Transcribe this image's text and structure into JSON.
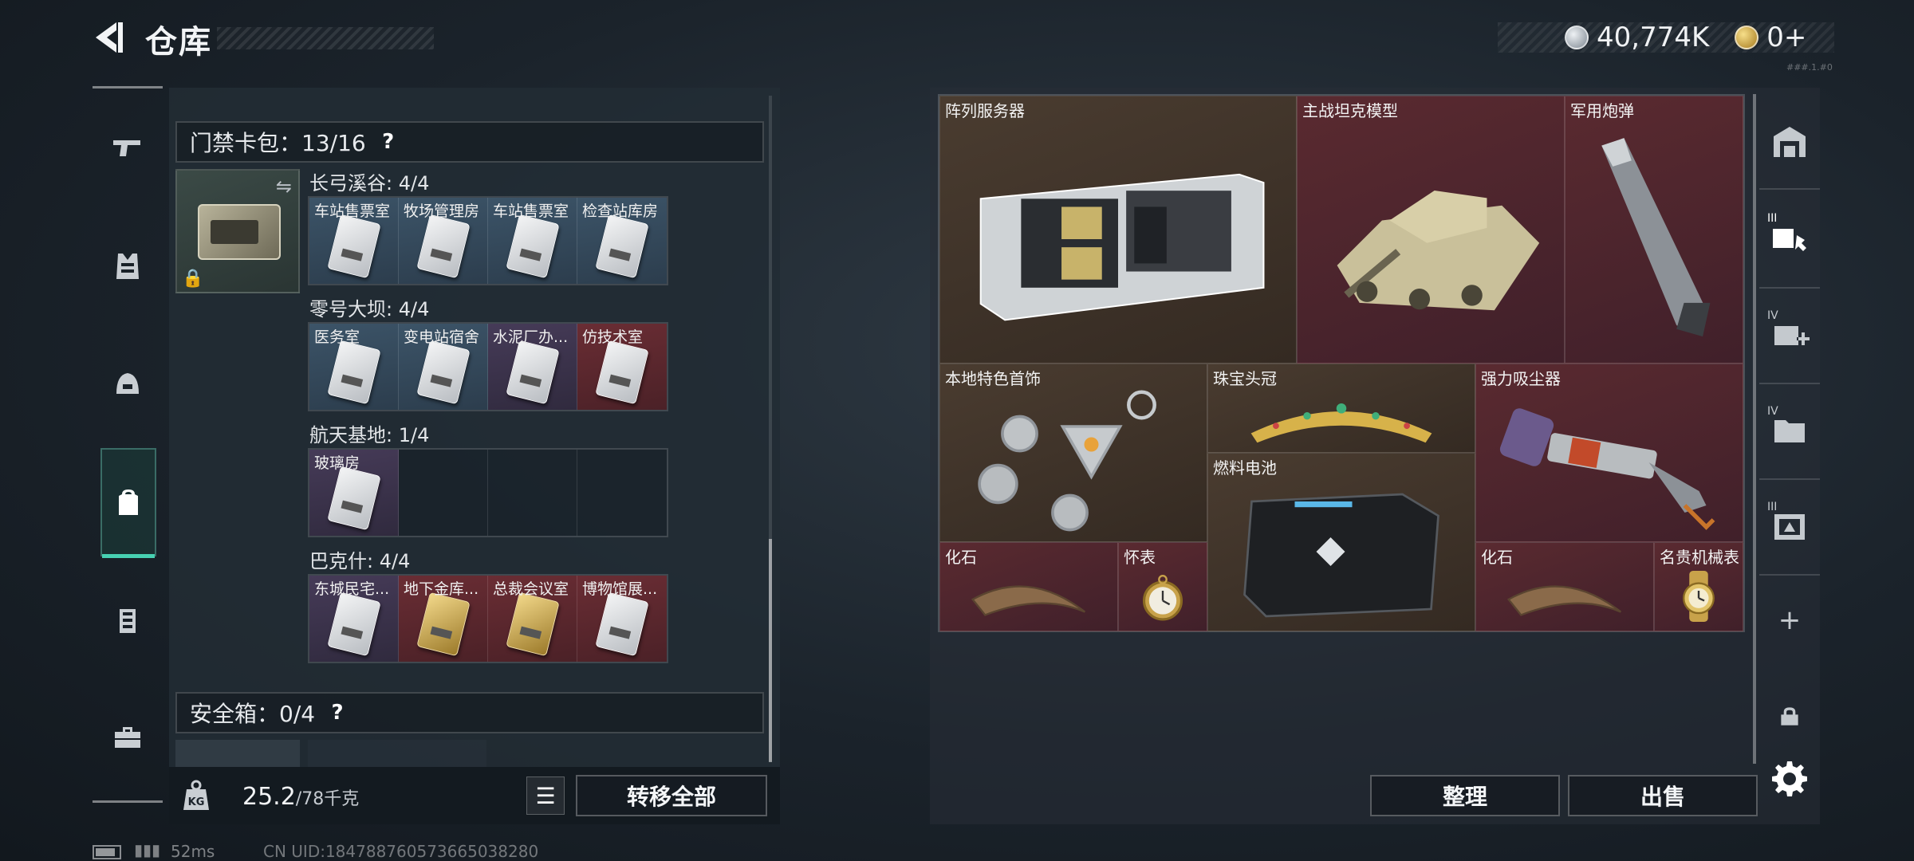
{
  "header": {
    "title": "仓库",
    "currency_silver": "40,774K",
    "currency_gold": "0+",
    "version": "###.1.#0"
  },
  "rail": {
    "items": [
      {
        "name": "weapons",
        "icon": "pistol-icon"
      },
      {
        "name": "armor",
        "icon": "vest-icon"
      },
      {
        "name": "helmets",
        "icon": "helmet-icon"
      },
      {
        "name": "backpack",
        "icon": "backpack-icon",
        "active": true
      },
      {
        "name": "chest-rig",
        "icon": "rig-icon"
      },
      {
        "name": "toolbox",
        "icon": "toolbox-icon"
      }
    ]
  },
  "keycards": {
    "header_label": "门禁卡包：13/16",
    "help_symbol": "?",
    "groups": [
      {
        "label": "长弓溪谷: 4/4",
        "cells": [
          {
            "name": "车站售票室",
            "color": "blue"
          },
          {
            "name": "牧场管理房",
            "color": "blue"
          },
          {
            "name": "车站售票室",
            "color": "blue"
          },
          {
            "name": "检查站库房",
            "color": "blue"
          }
        ]
      },
      {
        "label": "零号大坝: 4/4",
        "cells": [
          {
            "name": "医务室",
            "color": "blue"
          },
          {
            "name": "变电站宿舍",
            "color": "blue"
          },
          {
            "name": "水泥厂办...",
            "color": "purple"
          },
          {
            "name": "仿技术室",
            "color": "red"
          }
        ]
      },
      {
        "label": "航天基地: 1/4",
        "cells": [
          {
            "name": "玻璃房",
            "color": "purple"
          },
          {
            "name": "",
            "color": "empty"
          },
          {
            "name": "",
            "color": "empty"
          },
          {
            "name": "",
            "color": "empty"
          }
        ]
      },
      {
        "label": "巴克什: 4/4",
        "cells": [
          {
            "name": "东城民宅...",
            "color": "purple"
          },
          {
            "name": "地下金库...",
            "color": "red",
            "gold": true
          },
          {
            "name": "总裁会议室",
            "color": "red",
            "gold": true
          },
          {
            "name": "博物馆展...",
            "color": "red"
          }
        ]
      }
    ]
  },
  "safebox": {
    "header_label": "安全箱：0/4",
    "help_symbol": "?"
  },
  "weight": {
    "current": "25.2",
    "max": "/78千克"
  },
  "buttons": {
    "list": "☰",
    "transfer_all": "转移全部",
    "sort": "整理",
    "sell": "出售"
  },
  "stash_items": [
    {
      "name": "阵列服务器",
      "rarity": "brown",
      "art": "server"
    },
    {
      "name": "主战坦克模型",
      "rarity": "red",
      "art": "tank"
    },
    {
      "name": "军用炮弹",
      "rarity": "red",
      "art": "shell"
    },
    {
      "name": "本地特色首饰",
      "rarity": "brown",
      "art": "jewelry"
    },
    {
      "name": "珠宝头冠",
      "rarity": "brown",
      "art": "tiara"
    },
    {
      "name": "燃料电池",
      "rarity": "brown",
      "art": "battery"
    },
    {
      "name": "强力吸尘器",
      "rarity": "red",
      "art": "vacuum"
    },
    {
      "name": "化石",
      "rarity": "red",
      "art": "fossil"
    },
    {
      "name": "怀表",
      "rarity": "red",
      "art": "pocketwatch"
    },
    {
      "name": "化石",
      "rarity": "red",
      "art": "fossil"
    },
    {
      "name": "名贵机械表",
      "rarity": "red",
      "art": "wristwatch"
    }
  ],
  "tools": {
    "labels": [
      "III",
      "IV",
      "IV",
      "III",
      "+"
    ]
  },
  "status": {
    "ping": "52ms",
    "uid": "CN UID:1847887605736650382​80"
  }
}
